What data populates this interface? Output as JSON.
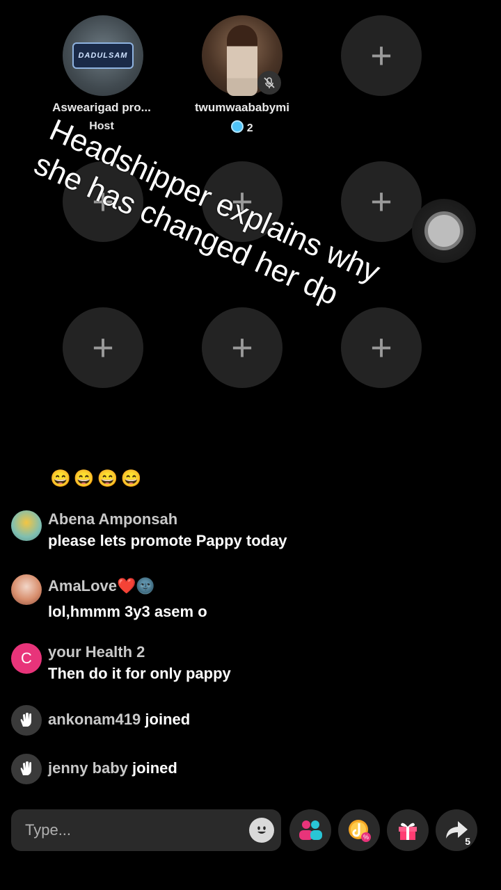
{
  "seats": {
    "host": {
      "name": "Aswearigad pro...",
      "role": "Host",
      "logo_text": "DADULSAM"
    },
    "guest": {
      "name": "twumwaababymi",
      "badge_count": "2"
    },
    "empty_plus": "+"
  },
  "overlay_caption": "Headshipper explains why she has changed her dp",
  "chat": {
    "emoji_row": "😄😄😄😄",
    "messages": [
      {
        "name": "Abena Amponsah",
        "text": "please lets promote Pappy today"
      },
      {
        "name": "AmaLove❤️🌚",
        "text": "lol,hmmm 3y3 asem o"
      },
      {
        "name": "your Health 2",
        "initial": "C",
        "text": "Then do it for only pappy"
      }
    ],
    "joins": [
      {
        "name": "ankonam419",
        "suffix": "joined"
      },
      {
        "name": "jenny baby",
        "suffix": "joined"
      }
    ]
  },
  "input": {
    "placeholder": "Type..."
  },
  "actions": {
    "share_count": "5"
  },
  "colors": {
    "background": "#000000",
    "slot": "#232323",
    "accent_pink": "#e8347a",
    "badge_blue": "#4fc3f7"
  }
}
